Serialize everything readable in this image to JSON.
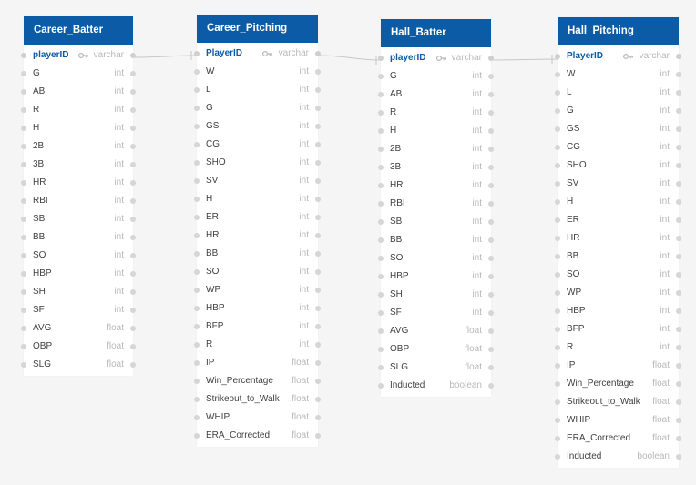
{
  "tables": [
    {
      "name": "Career_Batter",
      "fields": [
        {
          "name": "playerID",
          "type": "varchar",
          "pk": true
        },
        {
          "name": "G",
          "type": "int"
        },
        {
          "name": "AB",
          "type": "int"
        },
        {
          "name": "R",
          "type": "int"
        },
        {
          "name": "H",
          "type": "int"
        },
        {
          "name": "2B",
          "type": "int"
        },
        {
          "name": "3B",
          "type": "int"
        },
        {
          "name": "HR",
          "type": "int"
        },
        {
          "name": "RBI",
          "type": "int"
        },
        {
          "name": "SB",
          "type": "int"
        },
        {
          "name": "BB",
          "type": "int"
        },
        {
          "name": "SO",
          "type": "int"
        },
        {
          "name": "HBP",
          "type": "int"
        },
        {
          "name": "SH",
          "type": "int"
        },
        {
          "name": "SF",
          "type": "int"
        },
        {
          "name": "AVG",
          "type": "float"
        },
        {
          "name": "OBP",
          "type": "float"
        },
        {
          "name": "SLG",
          "type": "float"
        }
      ]
    },
    {
      "name": "Career_Pitching",
      "fields": [
        {
          "name": "PlayerID",
          "type": "varchar",
          "pk": true
        },
        {
          "name": "W",
          "type": "int"
        },
        {
          "name": "L",
          "type": "int"
        },
        {
          "name": "G",
          "type": "int"
        },
        {
          "name": "GS",
          "type": "int"
        },
        {
          "name": "CG",
          "type": "int"
        },
        {
          "name": "SHO",
          "type": "int"
        },
        {
          "name": "SV",
          "type": "int"
        },
        {
          "name": "H",
          "type": "int"
        },
        {
          "name": "ER",
          "type": "int"
        },
        {
          "name": "HR",
          "type": "int"
        },
        {
          "name": "BB",
          "type": "int"
        },
        {
          "name": "SO",
          "type": "int"
        },
        {
          "name": "WP",
          "type": "int"
        },
        {
          "name": "HBP",
          "type": "int"
        },
        {
          "name": "BFP",
          "type": "int"
        },
        {
          "name": "R",
          "type": "int"
        },
        {
          "name": "IP",
          "type": "float"
        },
        {
          "name": "Win_Percentage",
          "type": "float"
        },
        {
          "name": "Strikeout_to_Walk",
          "type": "float"
        },
        {
          "name": "WHIP",
          "type": "float"
        },
        {
          "name": "ERA_Corrected",
          "type": "float"
        }
      ]
    },
    {
      "name": "Hall_Batter",
      "fields": [
        {
          "name": "playerID",
          "type": "varchar",
          "pk": true
        },
        {
          "name": "G",
          "type": "int"
        },
        {
          "name": "AB",
          "type": "int"
        },
        {
          "name": "R",
          "type": "int"
        },
        {
          "name": "H",
          "type": "int"
        },
        {
          "name": "2B",
          "type": "int"
        },
        {
          "name": "3B",
          "type": "int"
        },
        {
          "name": "HR",
          "type": "int"
        },
        {
          "name": "RBI",
          "type": "int"
        },
        {
          "name": "SB",
          "type": "int"
        },
        {
          "name": "BB",
          "type": "int"
        },
        {
          "name": "SO",
          "type": "int"
        },
        {
          "name": "HBP",
          "type": "int"
        },
        {
          "name": "SH",
          "type": "int"
        },
        {
          "name": "SF",
          "type": "int"
        },
        {
          "name": "AVG",
          "type": "float"
        },
        {
          "name": "OBP",
          "type": "float"
        },
        {
          "name": "SLG",
          "type": "float"
        },
        {
          "name": "Inducted",
          "type": "boolean"
        }
      ]
    },
    {
      "name": "Hall_Pitching",
      "fields": [
        {
          "name": "PlayerID",
          "type": "varchar",
          "pk": true
        },
        {
          "name": "W",
          "type": "int"
        },
        {
          "name": "L",
          "type": "int"
        },
        {
          "name": "G",
          "type": "int"
        },
        {
          "name": "GS",
          "type": "int"
        },
        {
          "name": "CG",
          "type": "int"
        },
        {
          "name": "SHO",
          "type": "int"
        },
        {
          "name": "SV",
          "type": "int"
        },
        {
          "name": "H",
          "type": "int"
        },
        {
          "name": "ER",
          "type": "int"
        },
        {
          "name": "HR",
          "type": "int"
        },
        {
          "name": "BB",
          "type": "int"
        },
        {
          "name": "SO",
          "type": "int"
        },
        {
          "name": "WP",
          "type": "int"
        },
        {
          "name": "HBP",
          "type": "int"
        },
        {
          "name": "BFP",
          "type": "int"
        },
        {
          "name": "R",
          "type": "int"
        },
        {
          "name": "IP",
          "type": "float"
        },
        {
          "name": "Win_Percentage",
          "type": "float"
        },
        {
          "name": "Strikeout_to_Walk",
          "type": "float"
        },
        {
          "name": "WHIP",
          "type": "float"
        },
        {
          "name": "ERA_Corrected",
          "type": "float"
        },
        {
          "name": "Inducted",
          "type": "boolean"
        }
      ]
    }
  ],
  "colors": {
    "header_background": "#0b5ba6",
    "header_text": "#ffffff",
    "primary_key_text": "#0b5ba6",
    "type_text": "#b8b8b8",
    "connector": "#c8c8c8",
    "background": "#f5f5f5"
  },
  "icons": {
    "primary_key": "key-icon"
  }
}
